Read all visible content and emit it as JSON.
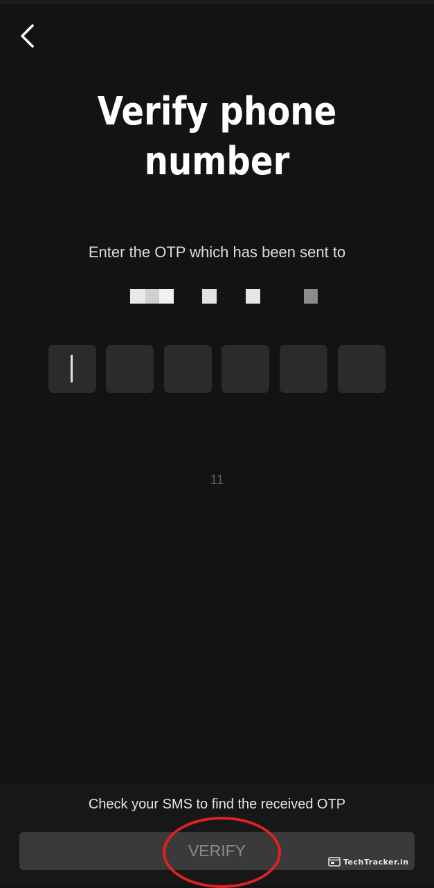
{
  "title": "Verify phone number",
  "subtitle": "Enter the OTP which has been sent to",
  "otp": {
    "digits": [
      "",
      "",
      "",
      "",
      "",
      ""
    ]
  },
  "timer": "11",
  "footer": {
    "hint": "Check your SMS to find the received OTP",
    "verify_label": "VERIFY"
  },
  "watermark": "TechTracker.in",
  "colors": {
    "background": "#131313",
    "box": "#2b2b2b",
    "button": "#3a3a3a",
    "highlight": "#dc2323"
  }
}
